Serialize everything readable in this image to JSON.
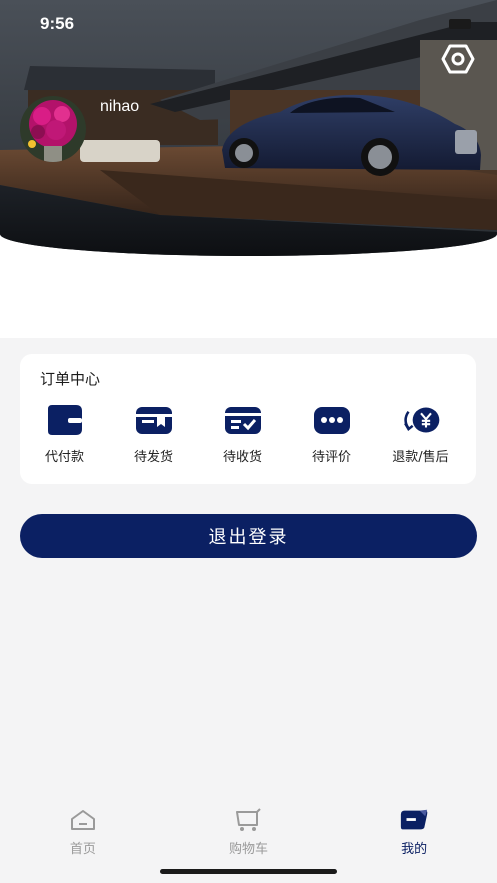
{
  "status_bar": {
    "time": "9:56"
  },
  "profile": {
    "username": "nihao"
  },
  "order_center": {
    "title": "订单中心",
    "items": [
      {
        "label": "代付款",
        "icon": "wallet-icon"
      },
      {
        "label": "待发货",
        "icon": "package-icon"
      },
      {
        "label": "待收货",
        "icon": "card-check-icon"
      },
      {
        "label": "待评价",
        "icon": "chat-bubble-icon"
      },
      {
        "label": "退款/售后",
        "icon": "refund-yen-icon"
      }
    ]
  },
  "logout": {
    "label": "退出登录"
  },
  "tabbar": {
    "tabs": [
      {
        "label": "首页",
        "icon": "home-icon",
        "active": false
      },
      {
        "label": "购物车",
        "icon": "cart-icon",
        "active": false
      },
      {
        "label": "我的",
        "icon": "profile-card-icon",
        "active": true
      }
    ]
  },
  "colors": {
    "accent": "#0b2063",
    "tab_inactive": "#9a9a9a",
    "background": "#f4f4f5"
  }
}
